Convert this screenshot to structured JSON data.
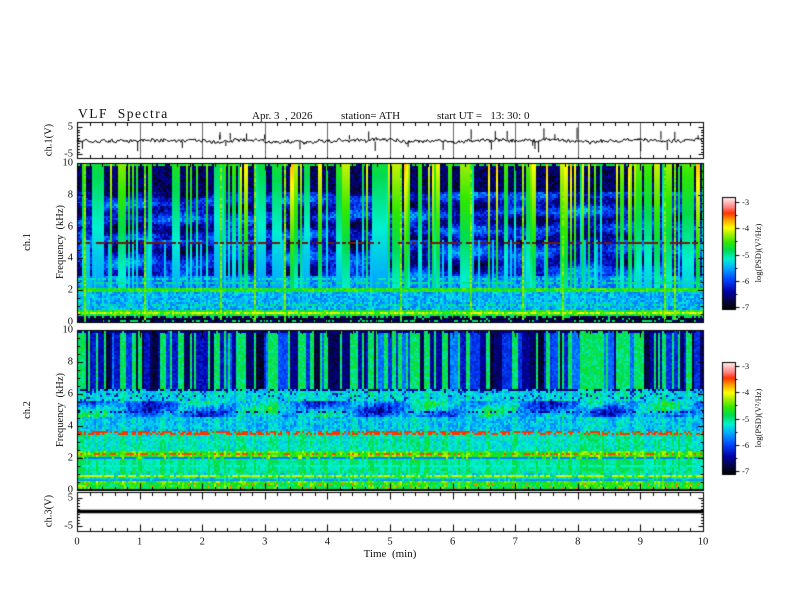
{
  "header": {
    "title": "VLF  Spectra",
    "date": "Apr. 3  , 2026",
    "station": "station= ATH",
    "start_ut": "start UT =   13: 30: 0"
  },
  "chart_data": {
    "type": "heatmap",
    "title": "VLF Spectra",
    "date": "Apr. 3 , 2026",
    "station": "ATH",
    "start_ut": "13:30:0",
    "x": {
      "label": "Time  (min)",
      "range": [
        0,
        10
      ],
      "ticks": [
        0,
        1,
        2,
        3,
        4,
        5,
        6,
        7,
        8,
        9,
        10
      ],
      "minor_step": 0.2
    },
    "panels": [
      {
        "id": "ch1_wave",
        "kind": "waveform",
        "ylabel": "ch.1(V)",
        "yticks": [
          5,
          -5
        ],
        "ylim": [
          -6.5,
          6.5
        ],
        "description": "noisy trace around 0 V with impulsive spikes up to about +/-5 V"
      },
      {
        "id": "ch1_spec",
        "kind": "spectrogram",
        "ylabel_ch": "ch.1",
        "ylabel_freq": "Frequency  (kHz)",
        "yticks": [
          0,
          2,
          4,
          6,
          8,
          10
        ],
        "ylim": [
          0,
          10
        ],
        "colorbar": {
          "label": "log(PSD)(V²/Hz)",
          "range": [
            -7,
            -3
          ],
          "ticks": [
            -3,
            -4,
            -5,
            -6,
            -7
          ]
        }
      },
      {
        "id": "ch2_spec",
        "kind": "spectrogram",
        "ylabel_ch": "ch.2",
        "ylabel_freq": "Frequency  (kHz)",
        "yticks": [
          0,
          2,
          4,
          6,
          8,
          10
        ],
        "ylim": [
          0,
          10
        ],
        "colorbar": {
          "label": "log(PSD)(V²/Hz)",
          "range": [
            -7,
            -3
          ],
          "ticks": [
            -3,
            -4,
            -5,
            -6,
            -7
          ]
        }
      },
      {
        "id": "ch3_wave",
        "kind": "waveform",
        "ylabel": "ch.3(V)",
        "yticks": [
          5,
          -5
        ],
        "ylim": [
          -6.5,
          6.5
        ],
        "description": "flat thick line at 0 V (no signal)"
      }
    ],
    "colormap": {
      "stops": [
        [
          0.0,
          "#000000"
        ],
        [
          0.06,
          "#06062e"
        ],
        [
          0.16,
          "#0000a8"
        ],
        [
          0.27,
          "#0048ff"
        ],
        [
          0.37,
          "#00aaff"
        ],
        [
          0.45,
          "#00f0d0"
        ],
        [
          0.53,
          "#00dc50"
        ],
        [
          0.6,
          "#30e800"
        ],
        [
          0.68,
          "#b4f000"
        ],
        [
          0.73,
          "#ffff00"
        ],
        [
          0.8,
          "#ffa000"
        ],
        [
          0.86,
          "#ff3200"
        ],
        [
          0.91,
          "#ff8080"
        ],
        [
          1.0,
          "#fff0f0"
        ]
      ]
    },
    "render": {
      "wave_ch1": {
        "seed": 33,
        "jitter": 1.5,
        "wander": 1.3,
        "spikes": 30,
        "amp_min": 5,
        "amp_max": 13
      },
      "spec_ch1": {
        "seed": 101,
        "streaks": {
          "p": 0.3,
          "persist": 0.4,
          "vmin": 0.5,
          "vmax": 0.78,
          "fmin": 2.3,
          "desc": "bright green vertical sferic streaks on dark background"
        },
        "thin": {
          "p": 0.1,
          "v": 0.4,
          "lo": 0.5,
          "hi": 5.3
        },
        "bright": {
          "p": 0.045,
          "v": 0.58
        },
        "bands": [
          {
            "lo": 8.3,
            "hi": 10.2,
            "base": 0.1,
            "noise": 0.07,
            "log_psd": -6.6
          },
          {
            "lo": 5.25,
            "hi": 8.3,
            "base": 0.2,
            "noise": 0.08,
            "patch": 0.1,
            "hstripe": {
              "n": 8,
              "amp": 0.06
            },
            "log_psd": -6.2
          },
          {
            "lo": 3.0,
            "hi": 5.25,
            "base": 0.21,
            "noise": 0.07,
            "patch": 0.12,
            "hstripe": {
              "n": 6,
              "amp": 0.05
            },
            "log_psd": -6.2
          },
          {
            "lo": 2.3,
            "hi": 3.0,
            "base": 0.33,
            "noise": 0.07,
            "log_psd": -5.7
          },
          {
            "lo": 1.95,
            "hi": 2.3,
            "base": 0.58,
            "noise": 0.06,
            "log_psd": -4.7,
            "desc": "yellow-green band near 2 kHz"
          },
          {
            "lo": 0.95,
            "hi": 1.95,
            "base": 0.38,
            "noise": 0.07,
            "log_psd": -5.5
          },
          {
            "lo": 0.5,
            "hi": 0.95,
            "base": 0.47,
            "noise": 0.08,
            "stripes": {
              "n": 3,
              "amp": 0.2
            },
            "log_psd": -5.1
          },
          {
            "lo": 0.18,
            "hi": 0.5,
            "base": 0.1,
            "noise": 0.05,
            "dash": {
              "p": 0.35,
              "v": 0.52
            },
            "log_psd": -6.6
          },
          {
            "lo": 0.0,
            "hi": 0.18,
            "base": 0.04,
            "noise": 0.03,
            "dash": {
              "p": 0.1,
              "v": 0.5
            },
            "log_psd": -6.8
          }
        ],
        "lines": [
          {
            "f": 9.93,
            "w": 0.09,
            "p": 0.75,
            "v": 0.55
          },
          {
            "f": 5.08,
            "w": 0.08,
            "p": 0.6,
            "color": "#701810",
            "desc": "maroon dotted line near 5.1 kHz"
          },
          {
            "f": 2.55,
            "w": 0.06,
            "p": 0.6,
            "v": 0.5
          },
          {
            "f": 2.82,
            "w": 0.06,
            "p": 0.45,
            "v": 0.47
          },
          {
            "f": 1.2,
            "w": 0.06,
            "p": 0.5,
            "v": 0.5
          },
          {
            "f": 0.3,
            "w": 0.06,
            "p": 0.8,
            "v": 0.05
          }
        ]
      },
      "spec_ch2": {
        "seed": 202,
        "dark": {
          "p": 0.42,
          "persist": 0.55,
          "fmin": 6.35,
          "desc": "dark blue vertical streaks on green background above 6.3 kHz"
        },
        "vshade": 0.06,
        "bands": [
          {
            "lo": 6.35,
            "hi": 10.2,
            "base": 0.52,
            "noise": 0.05,
            "streak2": true,
            "log_psd": -4.9
          },
          {
            "lo": 5.6,
            "hi": 6.35,
            "base": 0.47,
            "noise": 0.06,
            "dash": {
              "p": 0.1,
              "v": 0.2
            },
            "log_psd": -5.1
          },
          {
            "lo": 4.6,
            "hi": 5.6,
            "base": 0.4,
            "noise": 0.08,
            "patch": 0.18,
            "log_psd": -5.4
          },
          {
            "lo": 3.75,
            "hi": 4.6,
            "base": 0.44,
            "noise": 0.07,
            "log_psd": -5.2
          },
          {
            "lo": 2.45,
            "hi": 3.75,
            "base": 0.5,
            "noise": 0.06,
            "log_psd": -5.0
          },
          {
            "lo": 2.0,
            "hi": 2.45,
            "base": 0.64,
            "noise": 0.06,
            "log_psd": -4.4,
            "desc": "yellow-orange band near 2.2 kHz"
          },
          {
            "lo": 1.2,
            "hi": 2.0,
            "base": 0.53,
            "noise": 0.04,
            "log_psd": -4.9
          },
          {
            "lo": 0.5,
            "hi": 1.2,
            "base": 0.55,
            "noise": 0.07,
            "stripes": {
              "n": 2,
              "amp": 0.1
            },
            "log_psd": -4.8
          },
          {
            "lo": 0.18,
            "hi": 0.5,
            "base": 0.6,
            "noise": 0.08,
            "dash": {
              "p": 0.05,
              "v": 0.82
            },
            "log_psd": -4.6
          },
          {
            "lo": 0.0,
            "hi": 0.18,
            "base": 0.05,
            "noise": 0.03,
            "log_psd": -6.8
          }
        ],
        "lines": [
          {
            "f": 9.93,
            "w": 0.09,
            "p": 0.7,
            "v": 0.15
          },
          {
            "f": 6.28,
            "w": 0.07,
            "p": 0.6,
            "v": 0.12
          },
          {
            "f": 4.95,
            "w": 0.07,
            "p": 0.3,
            "v": 0.15
          },
          {
            "f": 3.6,
            "w": 0.09,
            "p": 0.55,
            "v": 0.86,
            "desc": "red dashed line near 3.6 kHz"
          },
          {
            "f": 2.3,
            "w": 0.07,
            "p": 0.35,
            "v": 0.85
          },
          {
            "f": 2.06,
            "w": 0.06,
            "p": 0.8,
            "v": 0.33
          },
          {
            "f": 1.62,
            "w": 0.06,
            "p": 0.7,
            "v": 0.45
          },
          {
            "f": 0.95,
            "w": 0.07,
            "p": 0.5,
            "v": 0.7
          },
          {
            "f": 0.72,
            "w": 0.06,
            "p": 0.8,
            "v": 0.35
          },
          {
            "f": 0.12,
            "w": 0.05,
            "p": 0.7,
            "v": 0.5
          }
        ]
      }
    }
  }
}
